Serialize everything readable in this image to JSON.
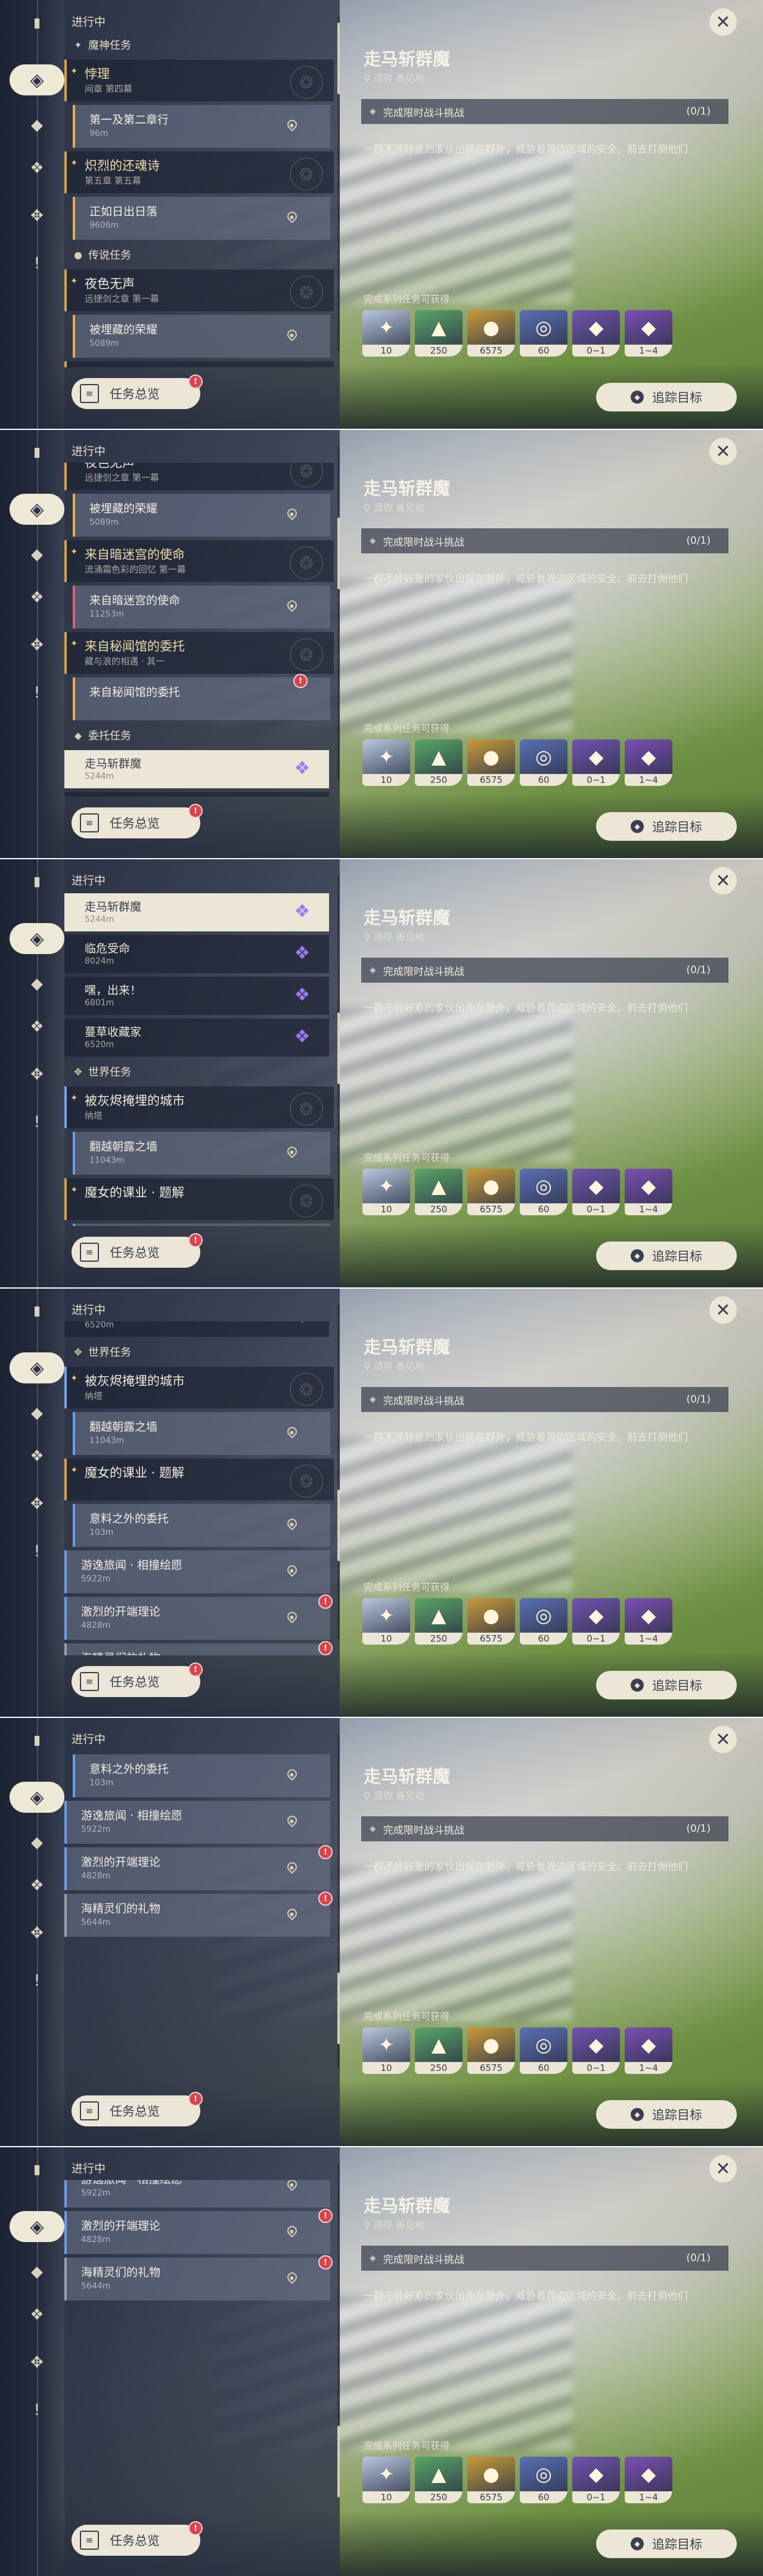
{
  "header": {
    "in_progress": "进行中"
  },
  "sidebar": {
    "icons": [
      {
        "name": "quest-book-icon",
        "glyph": "✦"
      },
      {
        "name": "all-quests-icon",
        "glyph": "◈"
      },
      {
        "name": "archon-quests-icon",
        "glyph": "◆"
      },
      {
        "name": "story-quests-icon",
        "glyph": "❖"
      },
      {
        "name": "world-quests-icon",
        "glyph": "✥"
      },
      {
        "name": "important-icon",
        "glyph": "!"
      }
    ]
  },
  "categories": {
    "archon": "魔神任务",
    "story": "传说任务",
    "commission": "委托任务",
    "world": "世界任务"
  },
  "quests": {
    "q1": {
      "title": "悖理",
      "subtitle": "间章 第四幕"
    },
    "q1_step": {
      "title": "第一及第二章行",
      "dist": "96m"
    },
    "q2": {
      "title": "炽烈的还魂诗",
      "subtitle": "第五章 第五幕"
    },
    "q2_step": {
      "title": "正如日出日落",
      "dist": "9606m"
    },
    "q3": {
      "title": "夜色无声",
      "subtitle": "远捷剑之章 第一幕"
    },
    "q3_step": {
      "title": "被埋藏的荣耀",
      "dist": "5089m"
    },
    "q4": {
      "title": "来自暗迷宫的使命",
      "subtitle": "流涌霜色彩的回忆 第一幕"
    },
    "q4_step": {
      "title": "来自暗迷宫的使命",
      "dist": "11253m"
    },
    "q5": {
      "title": "来自秘闻馆的委托",
      "subtitle": "藏与浪的相遇 · 其一"
    },
    "q5_step": {
      "title": "来自秘闻馆的委托",
      "dist": ""
    },
    "c1": {
      "title": "走马斩群魔",
      "dist": "5244m"
    },
    "c2": {
      "title": "临危受命",
      "dist": "8024m"
    },
    "c3": {
      "title": "嘿，出来！",
      "dist": "6801m"
    },
    "c4": {
      "title": "蔓草收藏家",
      "dist": "6520m"
    },
    "w1": {
      "title": "被灰烬掩埋的城市",
      "subtitle": "纳塔"
    },
    "w1_step": {
      "title": "翻越朝露之墙",
      "dist": "11043m"
    },
    "w2": {
      "title": "魔女的课业 · 题解",
      "subtitle": ""
    },
    "w2_step": {
      "title": "意料之外的委托",
      "dist": "103m"
    },
    "w3": {
      "title": "游逸旅闻 · 相撞绘愿",
      "dist": "5922m"
    },
    "w4": {
      "title": "激烈的开端理论",
      "dist": "4828m"
    },
    "w5": {
      "title": "海精灵们的礼物",
      "dist": "5644m"
    }
  },
  "detail": {
    "title": "走马斩群魔",
    "location": "须弥 善见地",
    "objective": "完成限时战斗挑战",
    "objective_count": "(0/1)",
    "description": "一群不怀好意的家伙出现在野外，威胁着周边区域的安全。前去打倒他们",
    "rewards_label": "完成系列任务可获得",
    "rewards": [
      {
        "name": "intertwined-fate-reward",
        "count": "10",
        "color": "#b8c7df",
        "glyph": "✦"
      },
      {
        "name": "adventure-exp-reward",
        "count": "250",
        "color": "#58a768",
        "glyph": "▲"
      },
      {
        "name": "mora-reward",
        "count": "6575",
        "color": "#c89a3a",
        "glyph": "●"
      },
      {
        "name": "companionship-exp-reward",
        "count": "60",
        "color": "#5a6fb5",
        "glyph": "◎"
      },
      {
        "name": "ore-reward",
        "count": "0~1",
        "color": "#7253b0",
        "glyph": "◆"
      },
      {
        "name": "crystal-reward",
        "count": "1~4",
        "color": "#7c4fb4",
        "glyph": "◆"
      }
    ],
    "track_label": "追踪目标",
    "close_glyph": "✕"
  },
  "footer": {
    "quest_overview": "任务总览"
  },
  "frames": [
    {
      "scroll": 0,
      "thumb": 10
    },
    {
      "scroll": 420,
      "thumb": 120
    },
    {
      "scroll": 900,
      "thumb": 230
    },
    {
      "scroll": 1150,
      "thumb": 310
    },
    {
      "scroll": 1450,
      "thumb": 400
    },
    {
      "scroll": 1560,
      "thumb": 440
    }
  ]
}
